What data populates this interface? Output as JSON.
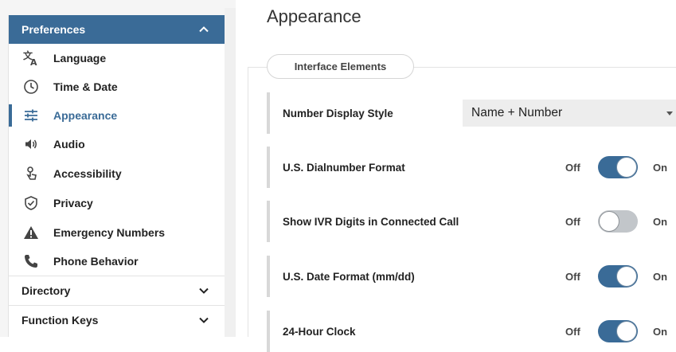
{
  "sidebar": {
    "preferences_label": "Preferences",
    "items": [
      {
        "label": "Language",
        "icon": "translate-icon"
      },
      {
        "label": "Time & Date",
        "icon": "clock-icon"
      },
      {
        "label": "Appearance",
        "icon": "sliders-icon",
        "selected": true
      },
      {
        "label": "Audio",
        "icon": "speaker-icon"
      },
      {
        "label": "Accessibility",
        "icon": "accessibility-hand-icon"
      },
      {
        "label": "Privacy",
        "icon": "shield-check-icon"
      },
      {
        "label": "Emergency Numbers",
        "icon": "warning-triangle-icon"
      },
      {
        "label": "Phone Behavior",
        "icon": "phone-icon"
      }
    ],
    "directory_label": "Directory",
    "function_keys_label": "Function Keys"
  },
  "main": {
    "title": "Appearance",
    "section_legend": "Interface Elements",
    "rows": [
      {
        "label": "Number Display Style",
        "type": "select",
        "value": "Name + Number"
      },
      {
        "label": "U.S. Dialnumber Format",
        "type": "toggle",
        "off": "Off",
        "on": "On",
        "state": true
      },
      {
        "label": "Show IVR Digits in Connected Call",
        "type": "toggle",
        "off": "Off",
        "on": "On",
        "state": false
      },
      {
        "label": "U.S. Date Format (mm/dd)",
        "type": "toggle",
        "off": "Off",
        "on": "On",
        "state": true
      },
      {
        "label": "24-Hour Clock",
        "type": "toggle",
        "off": "Off",
        "on": "On",
        "state": true
      }
    ]
  },
  "colors": {
    "accent": "#3a6b97",
    "toggle_off": "#c2c6ca"
  }
}
